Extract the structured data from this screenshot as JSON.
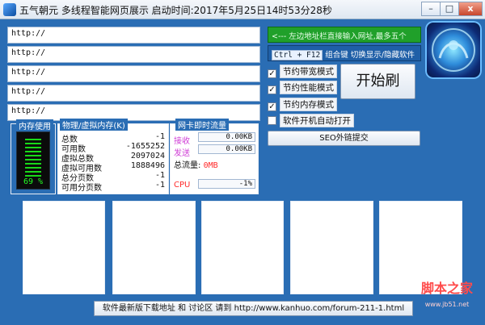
{
  "window": {
    "title": "五气朝元  多线程智能网页展示     启动时间:2017年5月25日14时53分28秒",
    "controls": {
      "minimize_label": "–",
      "maximize_label": "□",
      "close_label": "x"
    }
  },
  "urls": [
    {
      "value": "http://"
    },
    {
      "value": "http://"
    },
    {
      "value": "http://"
    },
    {
      "value": "http://"
    },
    {
      "value": "http://"
    }
  ],
  "hints": {
    "green": "<--- 左边地址栏直接输入网址,最多五个",
    "blue_key": "Ctrl + F12",
    "blue_text": " 组合键 切换显示/隐藏软件"
  },
  "options": [
    {
      "label": "节约带宽模式",
      "checked": true
    },
    {
      "label": "节约性能模式",
      "checked": true
    },
    {
      "label": "节约内存模式",
      "checked": true
    },
    {
      "label": "软件开机自动打开",
      "checked": false
    }
  ],
  "start_button_label": "开始刷",
  "seo_button_label": "SEO外链提交",
  "memory": {
    "title": "内存使用",
    "percent_text": "69 %",
    "percent": 69
  },
  "virtual_memory": {
    "title": "物理/虚拟内存(K)",
    "rows": [
      {
        "label": "总数",
        "value": "-1"
      },
      {
        "label": "可用数",
        "value": "-1655252"
      },
      {
        "label": "虚拟总数",
        "value": "2097024"
      },
      {
        "label": "虚拟可用数",
        "value": "1888496"
      },
      {
        "label": "总分页数",
        "value": "-1"
      },
      {
        "label": "可用分页数",
        "value": "-1"
      }
    ]
  },
  "network": {
    "title": "网卡即时流量",
    "receive_label": "接收",
    "receive_value": "0.00KB",
    "send_label": "发送",
    "send_value": "0.00KB",
    "total_label": "总流量:",
    "total_value": "0MB",
    "cpu_label": "CPU",
    "cpu_value": "-1%"
  },
  "bottom_bar": "软件最新版下载地址 和 讨论区 请到 http://www.kanhuo.com/forum-211-1.html",
  "watermark": {
    "title": "脚本之家",
    "url": "www.jb51.net"
  },
  "colors": {
    "accent": "#2a6db4",
    "hint_green": "#20a02a",
    "mem_green": "#25ff25",
    "red": "#ff2b2b"
  }
}
